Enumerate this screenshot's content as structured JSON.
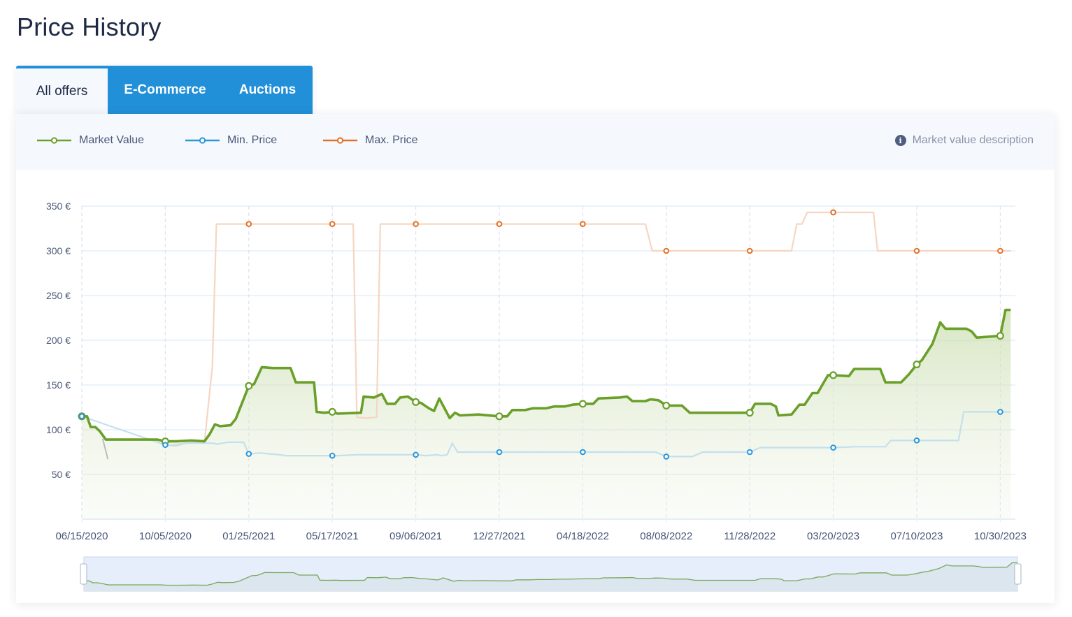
{
  "page": {
    "title": "Price History"
  },
  "tabs": [
    {
      "label": "All offers",
      "active": true
    },
    {
      "label": "E-Commerce",
      "active": false
    },
    {
      "label": "Auctions",
      "active": false
    }
  ],
  "legend": {
    "items": [
      {
        "label": "Market Value",
        "color": "#6a9f2a"
      },
      {
        "label": "Min. Price",
        "color": "#2a95db"
      },
      {
        "label": "Max. Price",
        "color": "#e0712a"
      }
    ],
    "description_link": "Market value description",
    "description_icon": "info-icon"
  },
  "chart_data": {
    "type": "line",
    "title": "Price History",
    "xlabel": "",
    "ylabel": "",
    "y_unit": "€",
    "ylim": [
      0,
      350
    ],
    "yticks": [
      50,
      100,
      150,
      200,
      250,
      300,
      350
    ],
    "ytick_labels": [
      "50 €",
      "100 €",
      "150 €",
      "200 €",
      "250 €",
      "300 €",
      "350 €"
    ],
    "x_unit": "weeks since 06/15/2020",
    "xlim": [
      0,
      178
    ],
    "xticks": [
      0,
      16,
      32,
      48,
      64,
      80,
      96,
      112,
      128,
      144,
      160,
      176
    ],
    "xtick_labels": [
      "06/15/2020",
      "10/05/2020",
      "01/25/2021",
      "05/17/2021",
      "09/06/2021",
      "12/27/2021",
      "04/18/2022",
      "08/08/2022",
      "11/28/2022",
      "03/20/2023",
      "07/10/2023",
      "10/30/2023"
    ],
    "grid": true,
    "legend_position": "top-left",
    "navigator": true,
    "series": [
      {
        "name": "Market Value",
        "color": "#6a9f2a",
        "area": true,
        "points": [
          [
            0,
            115
          ],
          [
            1,
            115
          ],
          [
            1.7,
            103
          ],
          [
            2.6,
            103
          ],
          [
            3.5,
            98
          ],
          [
            4.6,
            89
          ],
          [
            9,
            89
          ],
          [
            14.5,
            89
          ],
          [
            16,
            87
          ],
          [
            18,
            87
          ],
          [
            21,
            88
          ],
          [
            23.5,
            87
          ],
          [
            24.5,
            95
          ],
          [
            25.5,
            106
          ],
          [
            26.5,
            104
          ],
          [
            28.5,
            105
          ],
          [
            29.5,
            112
          ],
          [
            32,
            149
          ],
          [
            33,
            151
          ],
          [
            34.5,
            170
          ],
          [
            36.5,
            169
          ],
          [
            40,
            169
          ],
          [
            41,
            153
          ],
          [
            44.5,
            153
          ],
          [
            45,
            120
          ],
          [
            46.5,
            119
          ],
          [
            48,
            120
          ],
          [
            49,
            118
          ],
          [
            53.5,
            119
          ],
          [
            54,
            137
          ],
          [
            56,
            136
          ],
          [
            57.5,
            140
          ],
          [
            58.5,
            129
          ],
          [
            60,
            129
          ],
          [
            61,
            136
          ],
          [
            62.5,
            137
          ],
          [
            64,
            131
          ],
          [
            65,
            130
          ],
          [
            66.5,
            124
          ],
          [
            67.5,
            121
          ],
          [
            68.5,
            135
          ],
          [
            70.5,
            113
          ],
          [
            71.5,
            119
          ],
          [
            72.5,
            116
          ],
          [
            76,
            117
          ],
          [
            80,
            115
          ],
          [
            81.5,
            115
          ],
          [
            82.5,
            122
          ],
          [
            85,
            122
          ],
          [
            86.5,
            124
          ],
          [
            89,
            124
          ],
          [
            90.5,
            126
          ],
          [
            92.5,
            126
          ],
          [
            94,
            128
          ],
          [
            96,
            129
          ],
          [
            98,
            129
          ],
          [
            99,
            135
          ],
          [
            103,
            136
          ],
          [
            104.5,
            137
          ],
          [
            105.5,
            132
          ],
          [
            108,
            132
          ],
          [
            109,
            134
          ],
          [
            110.5,
            133
          ],
          [
            112,
            127
          ],
          [
            115,
            127
          ],
          [
            116.5,
            119
          ],
          [
            124,
            119
          ],
          [
            128,
            119
          ],
          [
            129,
            129
          ],
          [
            132,
            129
          ],
          [
            133,
            126
          ],
          [
            133.5,
            116
          ],
          [
            136,
            117
          ],
          [
            137.5,
            128
          ],
          [
            138.5,
            128
          ],
          [
            140,
            141
          ],
          [
            141,
            141
          ],
          [
            143,
            161
          ],
          [
            144,
            161
          ],
          [
            147,
            160
          ],
          [
            148,
            168
          ],
          [
            153,
            168
          ],
          [
            154,
            153
          ],
          [
            157,
            153
          ],
          [
            158.5,
            162
          ],
          [
            160,
            173
          ],
          [
            161,
            178
          ],
          [
            163,
            196
          ],
          [
            164.5,
            220
          ],
          [
            165.5,
            213
          ],
          [
            169.5,
            213
          ],
          [
            170.5,
            210
          ],
          [
            171.5,
            203
          ],
          [
            176,
            205
          ],
          [
            177,
            234
          ],
          [
            178,
            234
          ]
        ],
        "markers_at": [
          0,
          16,
          32,
          48,
          64,
          80,
          96,
          112,
          128,
          144,
          160,
          176
        ]
      },
      {
        "name": "Min. Price",
        "color": "#2a95db",
        "area": false,
        "points": [
          [
            0,
            115
          ],
          [
            16,
            83
          ],
          [
            18,
            82
          ],
          [
            20,
            85
          ],
          [
            22,
            85
          ],
          [
            25,
            85
          ],
          [
            26,
            84
          ],
          [
            28,
            86
          ],
          [
            31,
            86
          ],
          [
            32,
            73
          ],
          [
            34,
            74
          ],
          [
            36,
            73
          ],
          [
            38,
            72
          ],
          [
            39,
            71
          ],
          [
            45,
            71
          ],
          [
            48,
            71
          ],
          [
            49,
            71
          ],
          [
            53,
            72
          ],
          [
            55,
            72
          ],
          [
            64,
            72
          ],
          [
            66,
            71
          ],
          [
            68,
            72
          ],
          [
            69,
            71
          ],
          [
            70,
            72
          ],
          [
            71,
            85
          ],
          [
            72,
            75
          ],
          [
            80,
            75
          ],
          [
            96,
            75
          ],
          [
            110,
            75
          ],
          [
            112,
            70
          ],
          [
            117,
            70
          ],
          [
            119,
            75
          ],
          [
            128,
            75
          ],
          [
            130,
            80
          ],
          [
            144,
            80
          ],
          [
            148,
            81
          ],
          [
            154,
            81
          ],
          [
            155,
            88
          ],
          [
            160,
            88
          ],
          [
            168,
            88
          ],
          [
            169,
            120
          ],
          [
            176,
            120
          ],
          [
            178,
            120
          ]
        ],
        "markers_at": [
          0,
          16,
          32,
          48,
          64,
          80,
          96,
          112,
          128,
          144,
          160,
          176
        ]
      },
      {
        "name": "Max. Price",
        "color": "#e0712a",
        "area": false,
        "points": [
          [
            16,
            82
          ],
          [
            20,
            85
          ],
          [
            23.5,
            86
          ],
          [
            25,
            170
          ],
          [
            25.8,
            330
          ],
          [
            32,
            330
          ],
          [
            48,
            330
          ],
          [
            52,
            330
          ],
          [
            52.7,
            114
          ],
          [
            54.5,
            113
          ],
          [
            56.5,
            114
          ],
          [
            57.2,
            330
          ],
          [
            64,
            330
          ],
          [
            80,
            330
          ],
          [
            96,
            330
          ],
          [
            108,
            330
          ],
          [
            109.3,
            300
          ],
          [
            112,
            300
          ],
          [
            128,
            300
          ],
          [
            136,
            300
          ],
          [
            137,
            330
          ],
          [
            138,
            330
          ],
          [
            139,
            343
          ],
          [
            144,
            343
          ],
          [
            151.7,
            343
          ],
          [
            152.5,
            300
          ],
          [
            160,
            300
          ],
          [
            176,
            300
          ],
          [
            178,
            300
          ]
        ],
        "markers_at": [
          32,
          48,
          64,
          80,
          96,
          112,
          128,
          144,
          160,
          176
        ]
      }
    ],
    "stray_segment": {
      "color": "#b8bcc2",
      "points": [
        [
          4,
          90
        ],
        [
          5,
          67
        ]
      ]
    }
  }
}
